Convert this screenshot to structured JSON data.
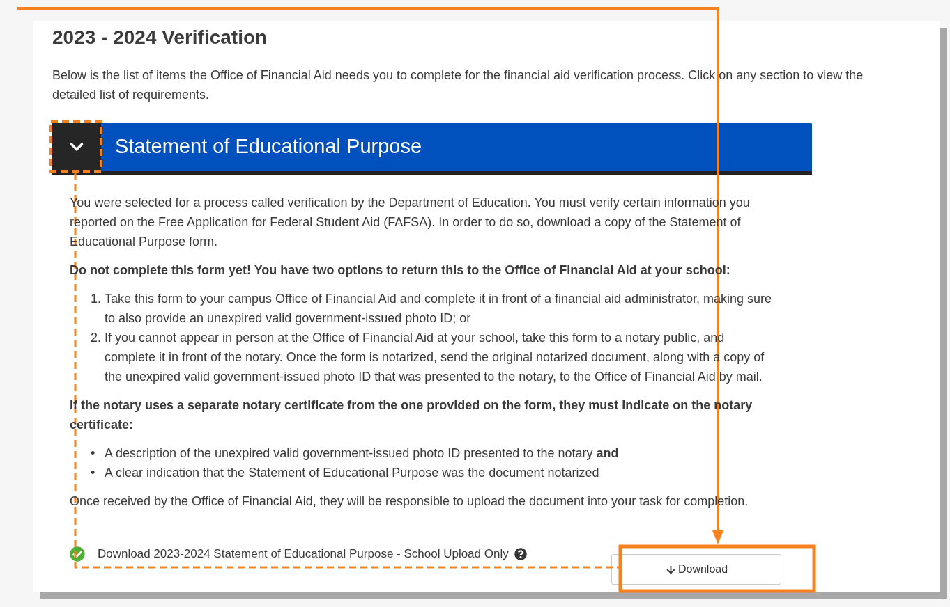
{
  "title": "2023 - 2024 Verification",
  "intro": "Below is the list of items the Office of Financial Aid needs you to complete for the financial aid verification process. Click on any section to view the detailed list of requirements.",
  "section": {
    "title": "Statement of Educational Purpose",
    "expanded": true,
    "blocks": [
      {
        "kind": "paragraph",
        "text": "You were selected for a process called verification by the Department of Education. You must verify certain information you reported on the Free Application for Federal Student Aid (FAFSA). In order to do so, download a copy of the Statement of Educational Purpose form."
      },
      {
        "kind": "strong",
        "text": "Do not complete this form yet! You have two options to return this to the Office of Financial Aid at your school:"
      },
      {
        "kind": "list",
        "items": [
          {
            "marker": "1.",
            "text": "Take this form to your campus Office of Financial Aid and complete it in front of a financial aid administrator, making sure to also provide an unexpired valid government-issued photo ID; or"
          },
          {
            "marker": "2.",
            "text": "If you cannot appear in person at the Office of Financial Aid at your school, take this form to a notary public, and complete it in front of the notary. Once the form is notarized, send the original notarized document, along with a copy of the unexpired valid government-issued photo ID that was presented to the notary, to the Office of Financial Aid by mail."
          }
        ]
      },
      {
        "kind": "strong",
        "text": "If the notary uses a separate notary certificate from the one provided on the form, they must indicate on the notary certificate:"
      },
      {
        "kind": "list",
        "items": [
          {
            "marker": "•",
            "text": "A description of the unexpired valid government-issued photo ID presented to the notary **and**"
          },
          {
            "marker": "•",
            "text": "A clear indication that the Statement of Educational Purpose was the document notarized"
          }
        ]
      },
      {
        "kind": "paragraph",
        "text": "Once received by the Office of Financial Aid, they will be responsible to upload the document into your task for completion."
      }
    ],
    "task": {
      "label": "Download 2023-2024 Statement of Educational Purpose - School Upload Only",
      "done": true,
      "button": "Download"
    }
  }
}
